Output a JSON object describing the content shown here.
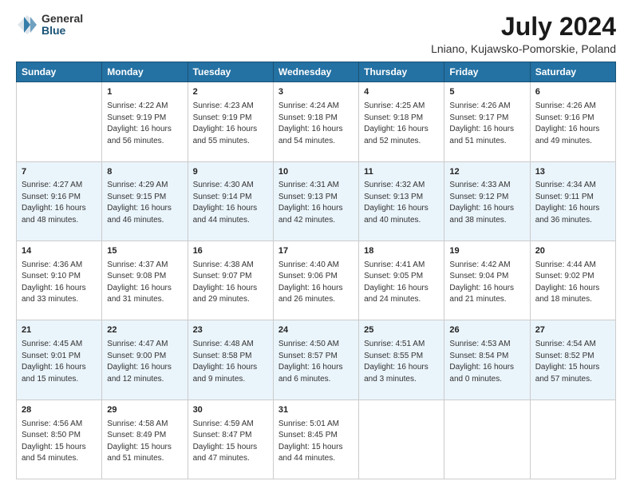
{
  "logo": {
    "general": "General",
    "blue": "Blue"
  },
  "title": "July 2024",
  "subtitle": "Lniano, Kujawsko-Pomorskie, Poland",
  "columns": [
    "Sunday",
    "Monday",
    "Tuesday",
    "Wednesday",
    "Thursday",
    "Friday",
    "Saturday"
  ],
  "weeks": [
    [
      {
        "day": "",
        "lines": []
      },
      {
        "day": "1",
        "lines": [
          "Sunrise: 4:22 AM",
          "Sunset: 9:19 PM",
          "Daylight: 16 hours",
          "and 56 minutes."
        ]
      },
      {
        "day": "2",
        "lines": [
          "Sunrise: 4:23 AM",
          "Sunset: 9:19 PM",
          "Daylight: 16 hours",
          "and 55 minutes."
        ]
      },
      {
        "day": "3",
        "lines": [
          "Sunrise: 4:24 AM",
          "Sunset: 9:18 PM",
          "Daylight: 16 hours",
          "and 54 minutes."
        ]
      },
      {
        "day": "4",
        "lines": [
          "Sunrise: 4:25 AM",
          "Sunset: 9:18 PM",
          "Daylight: 16 hours",
          "and 52 minutes."
        ]
      },
      {
        "day": "5",
        "lines": [
          "Sunrise: 4:26 AM",
          "Sunset: 9:17 PM",
          "Daylight: 16 hours",
          "and 51 minutes."
        ]
      },
      {
        "day": "6",
        "lines": [
          "Sunrise: 4:26 AM",
          "Sunset: 9:16 PM",
          "Daylight: 16 hours",
          "and 49 minutes."
        ]
      }
    ],
    [
      {
        "day": "7",
        "lines": [
          "Sunrise: 4:27 AM",
          "Sunset: 9:16 PM",
          "Daylight: 16 hours",
          "and 48 minutes."
        ]
      },
      {
        "day": "8",
        "lines": [
          "Sunrise: 4:29 AM",
          "Sunset: 9:15 PM",
          "Daylight: 16 hours",
          "and 46 minutes."
        ]
      },
      {
        "day": "9",
        "lines": [
          "Sunrise: 4:30 AM",
          "Sunset: 9:14 PM",
          "Daylight: 16 hours",
          "and 44 minutes."
        ]
      },
      {
        "day": "10",
        "lines": [
          "Sunrise: 4:31 AM",
          "Sunset: 9:13 PM",
          "Daylight: 16 hours",
          "and 42 minutes."
        ]
      },
      {
        "day": "11",
        "lines": [
          "Sunrise: 4:32 AM",
          "Sunset: 9:13 PM",
          "Daylight: 16 hours",
          "and 40 minutes."
        ]
      },
      {
        "day": "12",
        "lines": [
          "Sunrise: 4:33 AM",
          "Sunset: 9:12 PM",
          "Daylight: 16 hours",
          "and 38 minutes."
        ]
      },
      {
        "day": "13",
        "lines": [
          "Sunrise: 4:34 AM",
          "Sunset: 9:11 PM",
          "Daylight: 16 hours",
          "and 36 minutes."
        ]
      }
    ],
    [
      {
        "day": "14",
        "lines": [
          "Sunrise: 4:36 AM",
          "Sunset: 9:10 PM",
          "Daylight: 16 hours",
          "and 33 minutes."
        ]
      },
      {
        "day": "15",
        "lines": [
          "Sunrise: 4:37 AM",
          "Sunset: 9:08 PM",
          "Daylight: 16 hours",
          "and 31 minutes."
        ]
      },
      {
        "day": "16",
        "lines": [
          "Sunrise: 4:38 AM",
          "Sunset: 9:07 PM",
          "Daylight: 16 hours",
          "and 29 minutes."
        ]
      },
      {
        "day": "17",
        "lines": [
          "Sunrise: 4:40 AM",
          "Sunset: 9:06 PM",
          "Daylight: 16 hours",
          "and 26 minutes."
        ]
      },
      {
        "day": "18",
        "lines": [
          "Sunrise: 4:41 AM",
          "Sunset: 9:05 PM",
          "Daylight: 16 hours",
          "and 24 minutes."
        ]
      },
      {
        "day": "19",
        "lines": [
          "Sunrise: 4:42 AM",
          "Sunset: 9:04 PM",
          "Daylight: 16 hours",
          "and 21 minutes."
        ]
      },
      {
        "day": "20",
        "lines": [
          "Sunrise: 4:44 AM",
          "Sunset: 9:02 PM",
          "Daylight: 16 hours",
          "and 18 minutes."
        ]
      }
    ],
    [
      {
        "day": "21",
        "lines": [
          "Sunrise: 4:45 AM",
          "Sunset: 9:01 PM",
          "Daylight: 16 hours",
          "and 15 minutes."
        ]
      },
      {
        "day": "22",
        "lines": [
          "Sunrise: 4:47 AM",
          "Sunset: 9:00 PM",
          "Daylight: 16 hours",
          "and 12 minutes."
        ]
      },
      {
        "day": "23",
        "lines": [
          "Sunrise: 4:48 AM",
          "Sunset: 8:58 PM",
          "Daylight: 16 hours",
          "and 9 minutes."
        ]
      },
      {
        "day": "24",
        "lines": [
          "Sunrise: 4:50 AM",
          "Sunset: 8:57 PM",
          "Daylight: 16 hours",
          "and 6 minutes."
        ]
      },
      {
        "day": "25",
        "lines": [
          "Sunrise: 4:51 AM",
          "Sunset: 8:55 PM",
          "Daylight: 16 hours",
          "and 3 minutes."
        ]
      },
      {
        "day": "26",
        "lines": [
          "Sunrise: 4:53 AM",
          "Sunset: 8:54 PM",
          "Daylight: 16 hours",
          "and 0 minutes."
        ]
      },
      {
        "day": "27",
        "lines": [
          "Sunrise: 4:54 AM",
          "Sunset: 8:52 PM",
          "Daylight: 15 hours",
          "and 57 minutes."
        ]
      }
    ],
    [
      {
        "day": "28",
        "lines": [
          "Sunrise: 4:56 AM",
          "Sunset: 8:50 PM",
          "Daylight: 15 hours",
          "and 54 minutes."
        ]
      },
      {
        "day": "29",
        "lines": [
          "Sunrise: 4:58 AM",
          "Sunset: 8:49 PM",
          "Daylight: 15 hours",
          "and 51 minutes."
        ]
      },
      {
        "day": "30",
        "lines": [
          "Sunrise: 4:59 AM",
          "Sunset: 8:47 PM",
          "Daylight: 15 hours",
          "and 47 minutes."
        ]
      },
      {
        "day": "31",
        "lines": [
          "Sunrise: 5:01 AM",
          "Sunset: 8:45 PM",
          "Daylight: 15 hours",
          "and 44 minutes."
        ]
      },
      {
        "day": "",
        "lines": []
      },
      {
        "day": "",
        "lines": []
      },
      {
        "day": "",
        "lines": []
      }
    ]
  ]
}
